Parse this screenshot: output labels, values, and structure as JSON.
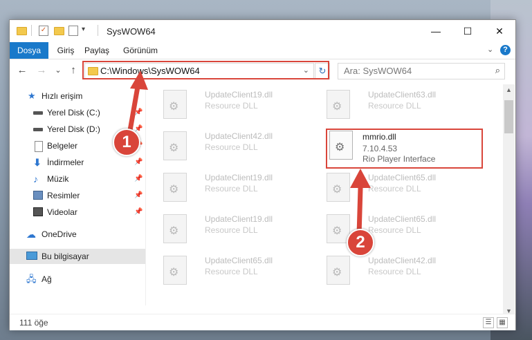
{
  "window": {
    "title": "SysWOW64"
  },
  "title_controls": {
    "minimize": "—",
    "maximize": "☐",
    "close": "✕"
  },
  "ribbon": {
    "tabs": [
      "Dosya",
      "Giriş",
      "Paylaş",
      "Görünüm"
    ],
    "expand_icon": "chevron-down-icon",
    "help_label": "?"
  },
  "nav": {
    "back": "←",
    "forward": "→",
    "recent": "⌄",
    "up": "↑",
    "address": "C:\\Windows\\SysWOW64",
    "search_placeholder": "Ara: SysWOW64"
  },
  "sidebar": {
    "items": [
      {
        "label": "Hızlı erişim",
        "icon": "star-icon",
        "pinned": false
      },
      {
        "label": "Yerel Disk (C:)",
        "icon": "disk-icon",
        "pinned": true
      },
      {
        "label": "Yerel Disk (D:)",
        "icon": "disk-icon",
        "pinned": true
      },
      {
        "label": "Belgeler",
        "icon": "document-icon",
        "pinned": true
      },
      {
        "label": "İndirmeler",
        "icon": "download-icon",
        "pinned": true
      },
      {
        "label": "Müzik",
        "icon": "music-icon",
        "pinned": true
      },
      {
        "label": "Resimler",
        "icon": "pictures-icon",
        "pinned": true
      },
      {
        "label": "Videolar",
        "icon": "videos-icon",
        "pinned": true
      },
      {
        "label": "OneDrive",
        "icon": "cloud-icon",
        "pinned": false
      },
      {
        "label": "Bu bilgisayar",
        "icon": "computer-icon",
        "pinned": false,
        "selected": true
      },
      {
        "label": "Ağ",
        "icon": "network-icon",
        "pinned": false
      }
    ]
  },
  "files": {
    "left_column": [
      {
        "name": "UpdateClient19.dll",
        "desc": "Resource DLL"
      },
      {
        "name": "UpdateClient42.dll",
        "desc": "Resource DLL"
      },
      {
        "name": "UpdateClient19.dll",
        "desc": "Resource DLL"
      },
      {
        "name": "UpdateClient19.dll",
        "desc": "Resource DLL"
      },
      {
        "name": "UpdateClient65.dll",
        "desc": "Resource DLL"
      }
    ],
    "right_column": [
      {
        "name": "UpdateClient63.dll",
        "desc": "Resource DLL"
      },
      {
        "name": "mmrio.dll",
        "version": "7.10.4.53",
        "desc": "Rio Player Interface",
        "active": true
      },
      {
        "name": "UpdateClient65.dll",
        "desc": "Resource DLL"
      },
      {
        "name": "UpdateClient65.dll",
        "desc": "Resource DLL"
      },
      {
        "name": "UpdateClient42.dll",
        "desc": "Resource DLL"
      }
    ]
  },
  "status": {
    "item_count": "111 öğe"
  },
  "callouts": {
    "step1": "1",
    "step2": "2",
    "color": "#d9453a"
  }
}
